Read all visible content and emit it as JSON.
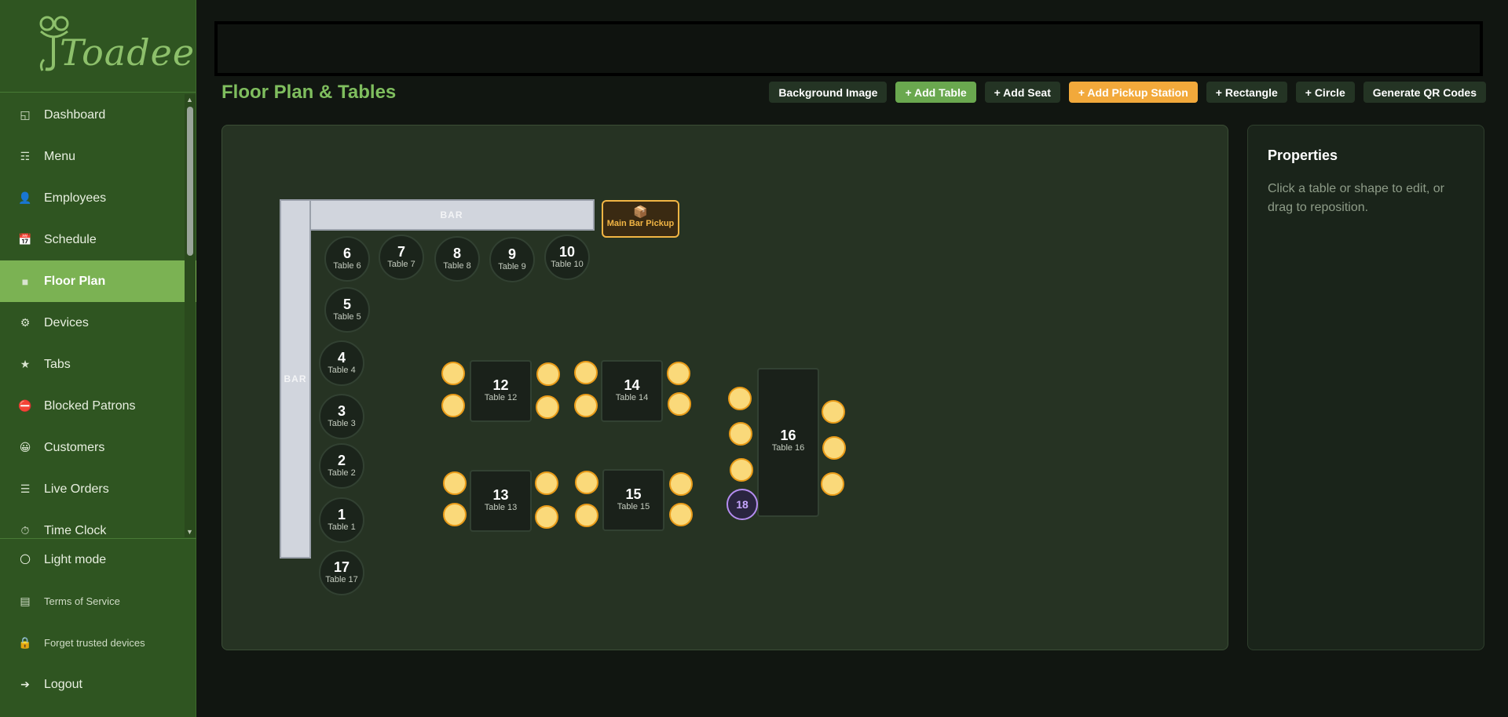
{
  "brand": {
    "name": "Toadee"
  },
  "nav": [
    {
      "label": "Dashboard",
      "icon": "◱",
      "name": "nav-item-dashboard",
      "iconName": "dashboard-icon"
    },
    {
      "label": "Menu",
      "icon": "☶",
      "name": "nav-item-menu",
      "iconName": "menu-list-icon"
    },
    {
      "label": "Employees",
      "icon": "👤",
      "name": "nav-item-employees",
      "iconName": "person-icon"
    },
    {
      "label": "Schedule",
      "icon": "📅",
      "name": "nav-item-schedule",
      "iconName": "calendar-icon"
    },
    {
      "label": "Floor Plan",
      "icon": "■",
      "name": "nav-item-floor-plan",
      "iconName": "floor-plan-icon",
      "active": true
    },
    {
      "label": "Devices",
      "icon": "⚙",
      "name": "nav-item-devices",
      "iconName": "gear-icon"
    },
    {
      "label": "Tabs",
      "icon": "★",
      "name": "nav-item-tabs",
      "iconName": "star-icon"
    },
    {
      "label": "Blocked Patrons",
      "icon": "⛔",
      "name": "nav-item-blocked-patrons",
      "iconName": "no-entry-icon"
    },
    {
      "label": "Customers",
      "icon": "😀",
      "name": "nav-item-customers",
      "iconName": "face-icon"
    },
    {
      "label": "Live Orders",
      "icon": "☰",
      "name": "nav-item-live-orders",
      "iconName": "list-icon"
    },
    {
      "label": "Time Clock",
      "icon": "⏱",
      "name": "nav-item-time-clock",
      "iconName": "clock-icon"
    }
  ],
  "footer": [
    {
      "label": "Light mode",
      "icon": "🌕",
      "name": "light-mode-toggle",
      "iconName": "sun-icon",
      "small": false
    },
    {
      "label": "Terms of Service",
      "icon": "▤",
      "name": "terms-of-service-link",
      "iconName": "document-icon",
      "small": true
    },
    {
      "label": "Forget trusted devices",
      "icon": "🔒",
      "name": "forget-trusted-devices-button",
      "iconName": "lock-icon",
      "small": true
    },
    {
      "label": "Logout",
      "icon": "➔",
      "name": "logout-button",
      "iconName": "arrow-right-icon",
      "small": false
    }
  ],
  "page": {
    "title": "Floor Plan & Tables"
  },
  "toolbar": {
    "background_image": "Background Image",
    "add_table": "+ Add Table",
    "add_seat": "+ Add Seat",
    "add_pickup_station": "+ Add Pickup Station",
    "rectangle": "+ Rectangle",
    "circle": "+ Circle",
    "generate_qr": "Generate QR Codes"
  },
  "floor": {
    "bar_label": "BAR",
    "pickup": {
      "icon": "📦",
      "label": "Main Bar Pickup"
    },
    "round_tables": [
      {
        "num": "6",
        "name": "Table 6"
      },
      {
        "num": "7",
        "name": "Table 7"
      },
      {
        "num": "8",
        "name": "Table 8"
      },
      {
        "num": "9",
        "name": "Table 9"
      },
      {
        "num": "10",
        "name": "Table 10"
      },
      {
        "num": "5",
        "name": "Table 5"
      },
      {
        "num": "4",
        "name": "Table 4"
      },
      {
        "num": "3",
        "name": "Table 3"
      },
      {
        "num": "2",
        "name": "Table 2"
      },
      {
        "num": "1",
        "name": "Table 1"
      },
      {
        "num": "17",
        "name": "Table 17"
      }
    ],
    "rect_tables": [
      {
        "num": "12",
        "name": "Table 12"
      },
      {
        "num": "14",
        "name": "Table 14"
      },
      {
        "num": "13",
        "name": "Table 13"
      },
      {
        "num": "15",
        "name": "Table 15"
      },
      {
        "num": "16",
        "name": "Table 16"
      }
    ],
    "seat_marker": "18"
  },
  "properties": {
    "title": "Properties",
    "hint": "Click a table or shape to edit, or drag to reposition."
  },
  "colors": {
    "accent": "#7bb253",
    "sidebar": "#2f5521",
    "seat": "#fad97a",
    "seat_border": "#e99b18",
    "pickup": "#f2b544"
  }
}
